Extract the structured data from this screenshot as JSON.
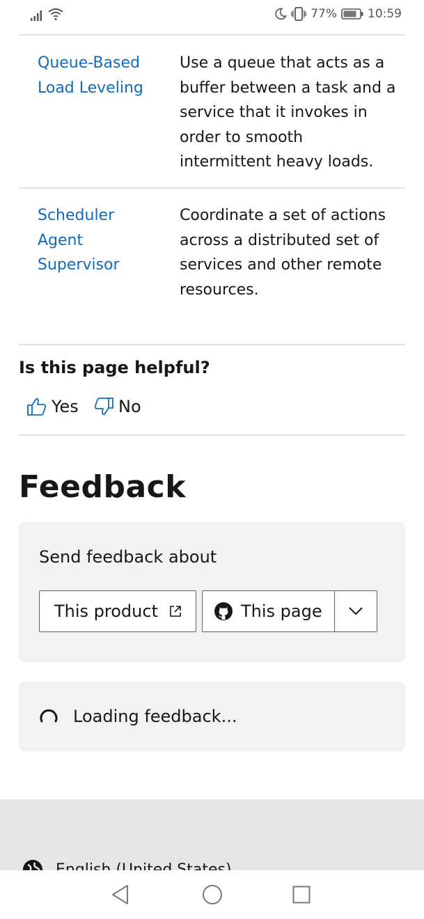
{
  "status_bar": {
    "battery_percent": "77%",
    "time": "10:59"
  },
  "rows": [
    {
      "link": "Queue-Based Load Leveling",
      "link_lines": [
        "Queue-Based",
        "Load Leveling"
      ],
      "desc_lines": [
        "Use a queue that acts as a",
        "buffer between a task and a",
        "service that it invokes in",
        "order to smooth",
        "intermittent heavy loads."
      ]
    },
    {
      "link": "Scheduler Agent Supervisor",
      "link_lines": [
        "Scheduler",
        "Agent",
        "Supervisor"
      ],
      "desc_lines": [
        "Coordinate a set of actions",
        "across a distributed set of",
        "services and other remote",
        "resources."
      ]
    }
  ],
  "helpful": {
    "title": "Is this page helpful?",
    "yes": "Yes",
    "no": "No"
  },
  "feedback": {
    "heading": "Feedback",
    "send_label": "Send feedback about",
    "product_button": "This product",
    "page_button": "This page",
    "loading": "Loading feedback..."
  },
  "footer": {
    "language": "English (United States)"
  },
  "colors": {
    "link": "#0f6cbd",
    "card_bg": "#f2f2f2",
    "footer_bg": "#e6e6e6"
  },
  "icons": [
    "signal-icon",
    "wifi-icon",
    "moon-icon",
    "vibrate-icon",
    "battery-icon",
    "thumbs-up-icon",
    "thumbs-down-icon",
    "external-link-icon",
    "github-icon",
    "chevron-down-icon",
    "spinner-icon",
    "globe-icon",
    "back-icon",
    "home-icon",
    "recents-icon"
  ]
}
